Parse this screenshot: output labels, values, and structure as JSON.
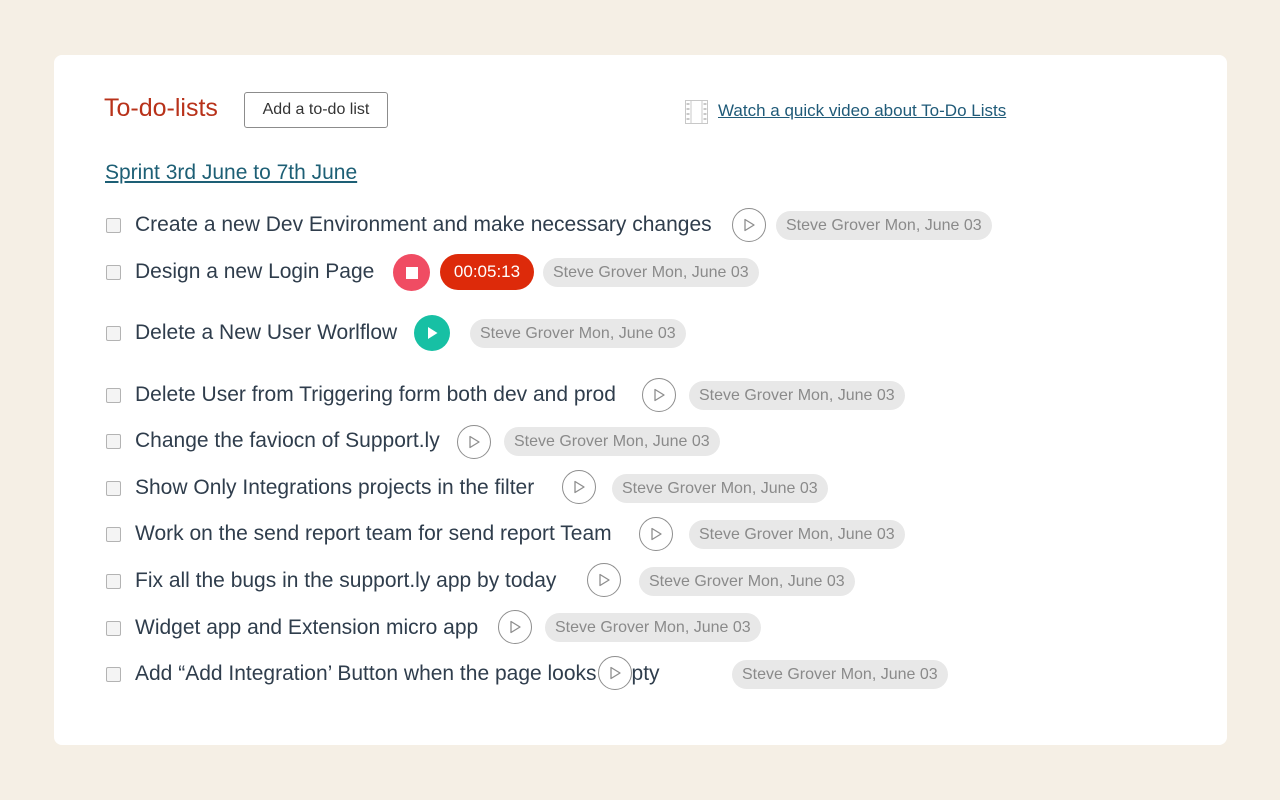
{
  "header": {
    "title": "To-do-lists",
    "add_button_label": "Add a to-do list",
    "video_icon": "film-icon",
    "video_link_label": "Watch a quick video about To-Do Lists"
  },
  "list": {
    "title": "Sprint 3rd June to 7th June",
    "tasks": [
      {
        "label": "Create a new Dev Environment and make necessary changes",
        "state": "idle",
        "meta": "Steve Grover Mon, June 03"
      },
      {
        "label": "Design a new Login Page",
        "state": "running",
        "timer": "00:05:13",
        "meta": "Steve Grover Mon, June 03"
      },
      {
        "label": "Delete a New User Worlflow",
        "state": "active",
        "meta": "Steve Grover Mon, June 03"
      },
      {
        "label": "Delete User from Triggering form both dev and prod",
        "state": "idle",
        "meta": "Steve Grover Mon, June 03"
      },
      {
        "label": "Change the faviocn of Support.ly",
        "state": "idle",
        "meta": "Steve Grover Mon, June 03"
      },
      {
        "label": "Show Only Integrations projects in the  filter",
        "state": "idle",
        "meta": "Steve Grover Mon, June 03"
      },
      {
        "label": "Work on the send report team for send report Team",
        "state": "idle",
        "meta": "Steve Grover Mon, June 03"
      },
      {
        "label": "Fix all the bugs in the support.ly app by today",
        "state": "idle",
        "meta": "Steve Grover Mon, June 03"
      },
      {
        "label": "Widget app and Extension micro app",
        "state": "idle",
        "meta": "Steve Grover Mon, June 03"
      },
      {
        "label": "Add “Add Integration’ Button when the page looks empty",
        "state": "idle",
        "meta": "Steve Grover Mon, June 03"
      }
    ]
  },
  "colors": {
    "title": "#b8321a",
    "link": "#1d5f75",
    "stop_button": "#f04c63",
    "timer": "#dd2a0a",
    "play_active": "#17c0a4",
    "tag_bg": "#e8e8e8"
  },
  "icons": {
    "idle": "play-outline-icon",
    "active": "play-filled-icon",
    "running": "stop-icon"
  }
}
